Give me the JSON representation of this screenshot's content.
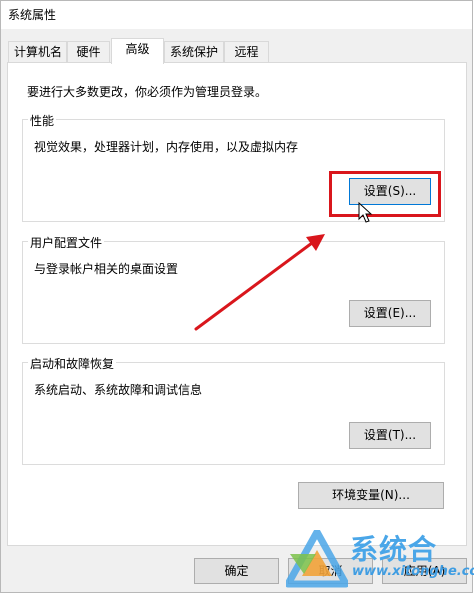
{
  "window": {
    "title": "系统属性"
  },
  "tabs": [
    {
      "label": "计算机名",
      "active": false
    },
    {
      "label": "硬件",
      "active": false
    },
    {
      "label": "高级",
      "active": true
    },
    {
      "label": "系统保护",
      "active": false
    },
    {
      "label": "远程",
      "active": false
    }
  ],
  "advanced": {
    "admin_note": "要进行大多数更改，你必须作为管理员登录。",
    "performance": {
      "label": "性能",
      "description": "视觉效果，处理器计划，内存使用，以及虚拟内存",
      "settings_button": "设置(S)..."
    },
    "user_profiles": {
      "label": "用户配置文件",
      "description": "与登录帐户相关的桌面设置",
      "settings_button": "设置(E)..."
    },
    "startup_recovery": {
      "label": "启动和故障恢复",
      "description": "系统启动、系统故障和调试信息",
      "settings_button": "设置(T)..."
    },
    "env_vars_button": "环境变量(N)..."
  },
  "footer": {
    "ok_button": "确定",
    "cancel_button": "取消",
    "apply_button": "应用(A)"
  },
  "watermark": {
    "name": "系统合",
    "url": "www.xitonghe.com"
  },
  "colors": {
    "highlight": "#d9161c",
    "focus_border": "#0078d7",
    "watermark_blue": "#4aa6e8"
  }
}
